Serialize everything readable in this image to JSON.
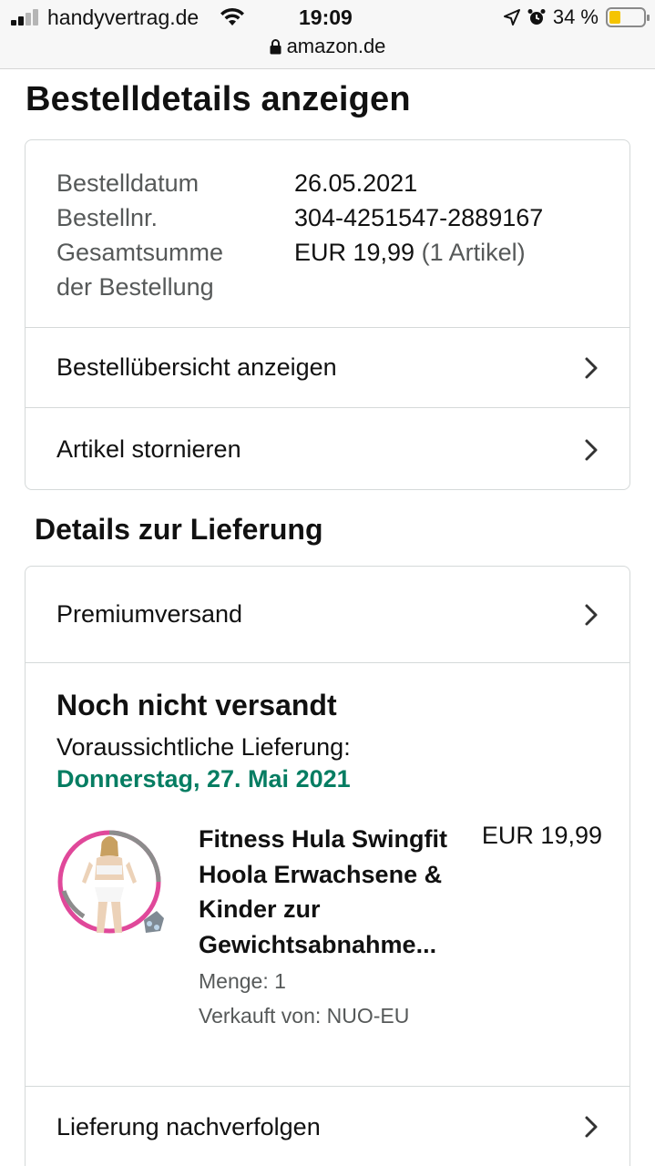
{
  "status_bar": {
    "carrier": "handyvertrag.de",
    "time": "19:09",
    "battery_percent": "34 %",
    "battery_level": 0.34,
    "url": "amazon.de",
    "icons": [
      "signal-icon",
      "wifi-icon",
      "location-arrow-icon",
      "alarm-icon",
      "battery-icon",
      "lock-icon"
    ]
  },
  "page": {
    "title": "Bestelldetails anzeigen"
  },
  "order": {
    "date_label": "Bestelldatum",
    "date_value": "26.05.2021",
    "number_label": "Bestellnr.",
    "number_value": "304-4251547-2889167",
    "total_label_line1": "Gesamtsumme",
    "total_label_line2": "der Bestellung",
    "total_value": "EUR 19,99",
    "total_items": "(1 Artikel)"
  },
  "order_actions": [
    {
      "label": "Bestellübersicht anzeigen",
      "icon": "chevron-right-icon"
    },
    {
      "label": "Artikel stornieren",
      "icon": "chevron-right-icon"
    }
  ],
  "delivery": {
    "section_title": "Details zur Lieferung",
    "shipping_method": "Premiumversand",
    "status": "Noch nicht versandt",
    "expected_label": "Voraussichtliche Lieferung:",
    "expected_date": "Donnerstag, 27. Mai 2021",
    "track_label": "Lieferung nachverfolgen"
  },
  "product": {
    "title": "Fitness Hula Swingfit Hoola Erwachsene & Kinder zur Gewichtsabnahme...",
    "price": "EUR 19,99",
    "quantity": "Menge: 1",
    "seller": "Verkauft von: NUO-EU",
    "colors": {
      "hoop_pink": "#e0489a",
      "hoop_gray": "#8c8c8c"
    }
  },
  "colors": {
    "accent_green": "#067d62",
    "border": "#d5d9d9",
    "muted_text": "#565959",
    "battery_fill": "#f5c400"
  }
}
